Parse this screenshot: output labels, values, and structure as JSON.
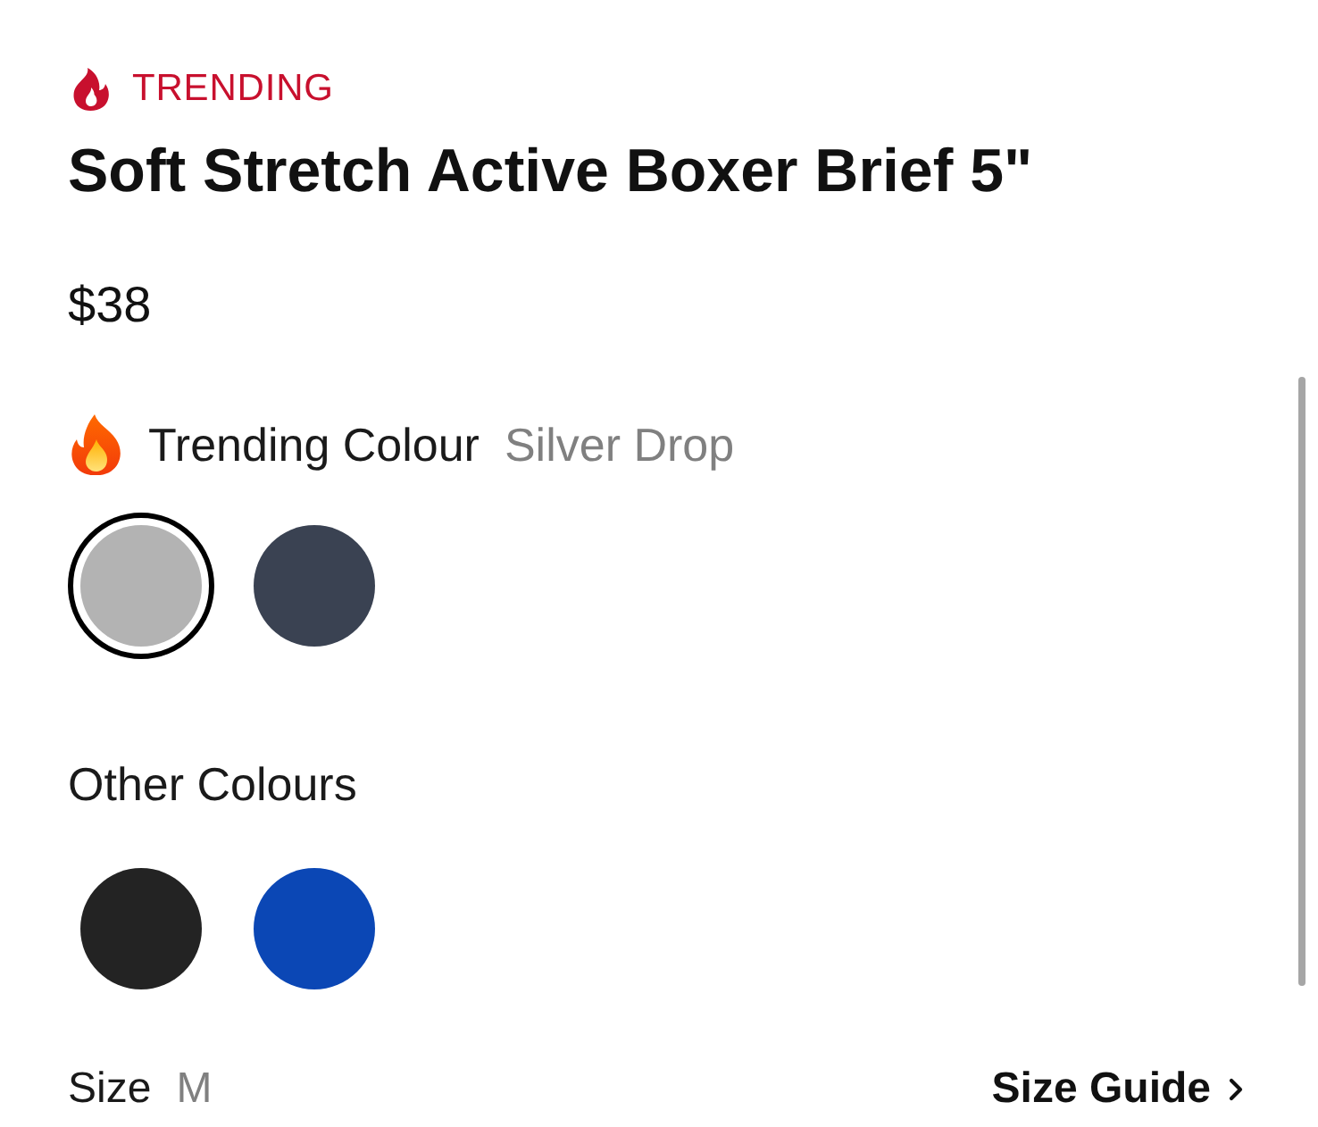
{
  "badge": {
    "label": "TRENDING"
  },
  "product": {
    "title": "Soft Stretch Active Boxer Brief 5\"",
    "price": "$38"
  },
  "trending_colours": {
    "label": "Trending Colour",
    "selected_name": "Silver Drop",
    "swatches": [
      {
        "color": "#b3b3b3",
        "selected": true
      },
      {
        "color": "#3a4252",
        "selected": false
      }
    ]
  },
  "other_colours": {
    "label": "Other Colours",
    "swatches": [
      {
        "color": "#232323",
        "selected": false
      },
      {
        "color": "#0b47b5",
        "selected": false
      }
    ]
  },
  "size": {
    "label": "Size",
    "value": "M",
    "guide_link": "Size Guide"
  }
}
